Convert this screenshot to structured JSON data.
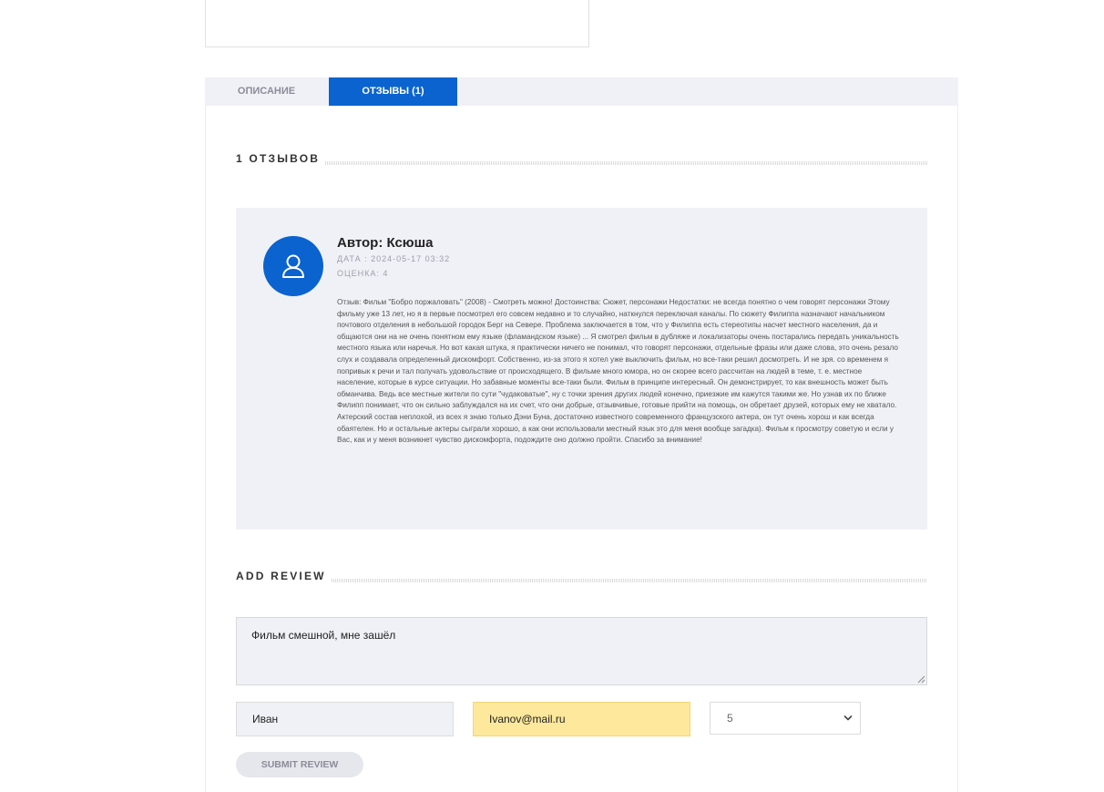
{
  "tabs": [
    {
      "label": "ОПИСАНИЕ"
    },
    {
      "label": "ОТЗЫВЫ (1)"
    }
  ],
  "reviews_heading": "1 ОТЗЫВОВ",
  "review": {
    "avatar_icon": "user-icon",
    "author": "Автор: Ксюша",
    "date": "ДАТА : 2024-05-17 03:32",
    "rating": "ОЦЕНКА: 4",
    "text": "Отзыв: Фильм \"Бобро поржаловать\" (2008) - Смотреть можно! Достоинства: Сюжет, персонажи Недостатки: не всегда понятно о чем говорят персонажи Этому фильму уже 13 лет, но я в первые посмотрел его совсем недавно и то случайно, наткнулся переключая каналы. По сюжету Филиппа назначают начальником почтового отделения в небольшой городок Берг на Севере. Проблема заключается в том, что у Филиппа есть стереотипы насчет местного населения, да и общаются они на не очень понятном ему языке (фламандском языке) ... Я смотрел фильм в дубляже и локализаторы очень постарались передать уникальность местного языка или наречья. Но вот какая штука, я практически ничего не понимал, что говорят персонажи, отдельные фразы или даже слова, это очень резало слух и создавала определенный дискомфорт. Собственно, из-за этого я хотел уже выключить фильм, но все-таки решил досмотреть. И не зря. со временем я попривык к речи и тал получать удовольствие от происходящего. В фильме много юмора, но он скорее всего рассчитан на людей в теме, т. е. местное население, которые в курсе ситуации. Но забавные моменты все-таки были. Фильм в принципе интересный. Он демонстрирует, то как внешность может быть обманчива. Ведь все местные жители по сути \"чудаковатые\", ну с точки зрения других людей конечно, приезжие им кажутся такими же. Но узнав их по ближе Филипп понимает, что он сильно заблуждался на их счет, что они добрые, отзывчивые, готовые прийти на помощь, он обретает друзей, которых ему не хватало. Актерский состав неплохой, из всех я знаю только Дэни Буна, достаточно известного современного французского актера, он тут очень хорош и как всегда обаятелен. Но и остальные актеры сыграли хорошо, а как они использовали местный язык это для меня вообще загадка). Фильм к просмотру советую и если у Вас, как и у меня возникнет чувство дискомфорта, подождите оно должно пройти. Спасибо за внимание!"
  },
  "add_review": {
    "heading": "ADD REVIEW",
    "comment_value": "Фильм смешной, мне зашёл",
    "name_value": "Иван",
    "email_value": "Ivanov@mail.ru",
    "rating_selected": "5",
    "submit_label": "SUBMIT REVIEW"
  },
  "colors": {
    "accent": "#0a63cf",
    "card_bg": "#f0f1f6",
    "autofill": "#fde89b"
  }
}
